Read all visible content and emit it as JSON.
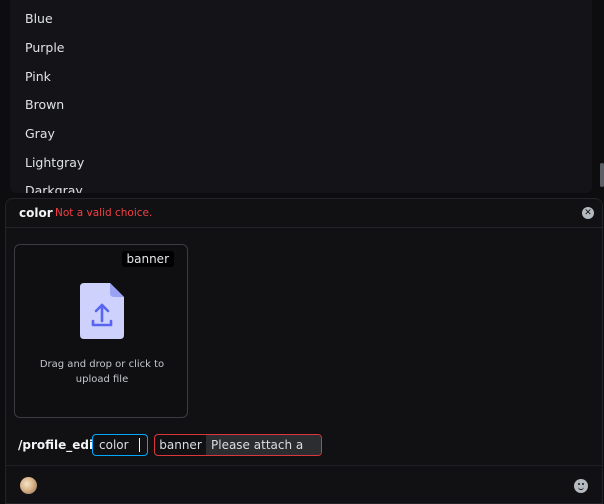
{
  "dropdown": {
    "items": [
      {
        "label": "Blue"
      },
      {
        "label": "Purple"
      },
      {
        "label": "Pink"
      },
      {
        "label": "Brown"
      },
      {
        "label": "Gray"
      },
      {
        "label": "Lightgray"
      },
      {
        "label": "Darkgray"
      }
    ]
  },
  "panel": {
    "option_name": "color",
    "option_error": "Not a valid choice.",
    "close_icon": "close-icon",
    "upload": {
      "tag": "banner",
      "hint": "Drag and drop or click to upload file",
      "icon": "file-upload-icon"
    }
  },
  "command": {
    "name": "/profile_edit",
    "options": [
      {
        "name": "color",
        "value": ""
      },
      {
        "name": "banner",
        "value": "Please attach a file"
      }
    ]
  },
  "footer": {
    "avatar_icon": "avatar",
    "emoji_icon": "emoji-icon"
  },
  "colors": {
    "accent_focus": "#00a8fc",
    "error": "#f23f43",
    "upload_icon": "#949cf7"
  }
}
